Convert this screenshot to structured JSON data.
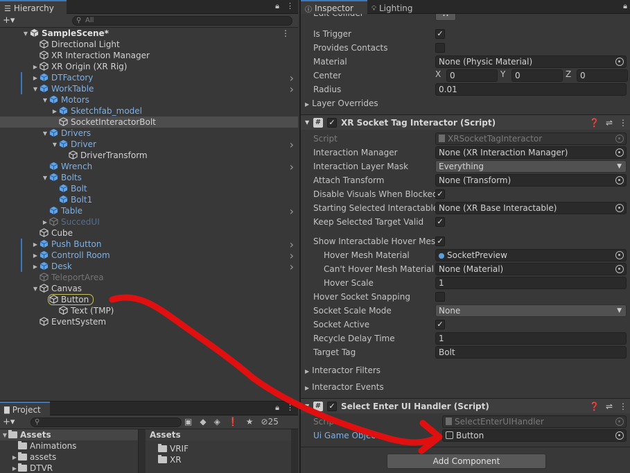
{
  "hierarchy": {
    "tab": "Hierarchy",
    "search_placeholder": "All",
    "items": [
      {
        "label": "SampleScene*",
        "indent": 0,
        "fold": "open",
        "kind": "scene"
      },
      {
        "label": "Directional Light",
        "indent": 1,
        "fold": "",
        "kind": "normal"
      },
      {
        "label": "XR Interaction Manager",
        "indent": 1,
        "fold": "",
        "kind": "normal"
      },
      {
        "label": "XR Origin (XR Rig)",
        "indent": 1,
        "fold": "closed",
        "kind": "normal"
      },
      {
        "label": "DTFactory",
        "indent": 1,
        "fold": "closed",
        "kind": "prefab",
        "arrow": true,
        "bar": true
      },
      {
        "label": "WorkTable",
        "indent": 1,
        "fold": "open",
        "kind": "prefab",
        "arrow": true,
        "bar": true
      },
      {
        "label": "Motors",
        "indent": 2,
        "fold": "open",
        "kind": "prefab"
      },
      {
        "label": "Sketchfab_model",
        "indent": 3,
        "fold": "closed",
        "kind": "prefab"
      },
      {
        "label": "SocketInteractorBolt",
        "indent": 3,
        "fold": "",
        "kind": "normal",
        "selected": true
      },
      {
        "label": "Drivers",
        "indent": 2,
        "fold": "open",
        "kind": "prefab"
      },
      {
        "label": "Driver",
        "indent": 3,
        "fold": "open",
        "kind": "prefab",
        "arrow": true
      },
      {
        "label": "DriverTransform",
        "indent": 4,
        "fold": "",
        "kind": "normal"
      },
      {
        "label": "Wrench",
        "indent": 2,
        "fold": "",
        "kind": "prefab",
        "arrow": true
      },
      {
        "label": "Bolts",
        "indent": 2,
        "fold": "open",
        "kind": "prefab"
      },
      {
        "label": "Bolt",
        "indent": 3,
        "fold": "",
        "kind": "prefab"
      },
      {
        "label": "Bolt1",
        "indent": 3,
        "fold": "",
        "kind": "prefab"
      },
      {
        "label": "Table",
        "indent": 2,
        "fold": "",
        "kind": "prefab",
        "arrow": true
      },
      {
        "label": "SuccedUI",
        "indent": 2,
        "fold": "closed",
        "kind": "dimblue"
      },
      {
        "label": "Cube",
        "indent": 1,
        "fold": "",
        "kind": "normal"
      },
      {
        "label": "Push Button",
        "indent": 1,
        "fold": "closed",
        "kind": "prefab",
        "arrow": true,
        "bar": true
      },
      {
        "label": "Controll Room",
        "indent": 1,
        "fold": "closed",
        "kind": "prefab",
        "arrow": true,
        "bar": true
      },
      {
        "label": "Desk",
        "indent": 1,
        "fold": "closed",
        "kind": "prefab",
        "arrow": true,
        "bar": true
      },
      {
        "label": "TeleportArea",
        "indent": 1,
        "fold": "",
        "kind": "dim"
      },
      {
        "label": "Canvas",
        "indent": 1,
        "fold": "open",
        "kind": "normal"
      },
      {
        "label": "Button",
        "indent": 2,
        "fold": "",
        "kind": "normal",
        "highlight": true
      },
      {
        "label": "Text (TMP)",
        "indent": 3,
        "fold": "",
        "kind": "normal"
      },
      {
        "label": "EventSystem",
        "indent": 1,
        "fold": "",
        "kind": "normal"
      }
    ]
  },
  "project": {
    "tab": "Project",
    "hidden_count": "25",
    "tree": [
      {
        "label": "Assets",
        "fold": "open",
        "head": true
      },
      {
        "label": "Animations",
        "fold": ""
      },
      {
        "label": "assets",
        "fold": "closed"
      },
      {
        "label": "DTVR",
        "fold": "closed"
      }
    ],
    "breadcrumb": "Assets",
    "files": [
      "VRIF",
      "XR"
    ]
  },
  "inspector": {
    "tabs": [
      "Inspector",
      "Lighting"
    ],
    "collider": {
      "edit_collider": "Edit Collider",
      "is_trigger": {
        "label": "Is Trigger",
        "checked": true
      },
      "provides_contacts": {
        "label": "Provides Contacts",
        "checked": false
      },
      "material": {
        "label": "Material",
        "value": "None (Physic Material)"
      },
      "center": {
        "label": "Center",
        "x_label": "X",
        "x": "0",
        "y_label": "Y",
        "y": "0",
        "z_label": "Z",
        "z": "0"
      },
      "radius": {
        "label": "Radius",
        "value": "0.01"
      },
      "layer_overrides": "Layer Overrides"
    },
    "socket": {
      "title": "XR Socket Tag Interactor (Script)",
      "script": {
        "label": "Script",
        "value": "XRSocketTagInteractor"
      },
      "interaction_manager": {
        "label": "Interaction Manager",
        "value": "None (XR Interaction Manager)"
      },
      "layer_mask": {
        "label": "Interaction Layer Mask",
        "value": "Everything"
      },
      "attach_transform": {
        "label": "Attach Transform",
        "value": "None (Transform)"
      },
      "disable_visuals": {
        "label": "Disable Visuals When Blocked In",
        "checked": true
      },
      "starting_selected": {
        "label": "Starting Selected Interactable",
        "value": "None (XR Base Interactable)"
      },
      "keep_selected": {
        "label": "Keep Selected Target Valid",
        "checked": true
      },
      "show_hover": {
        "label": "Show Interactable Hover Meshes",
        "checked": true
      },
      "hover_mesh_material": {
        "label": "Hover Mesh Material",
        "value": "SocketPreview"
      },
      "cant_hover_material": {
        "label": "Can't Hover Mesh Material",
        "value": "None (Material)"
      },
      "hover_scale": {
        "label": "Hover Scale",
        "value": "1"
      },
      "hover_snapping": {
        "label": "Hover Socket Snapping",
        "checked": false
      },
      "scale_mode": {
        "label": "Socket Scale Mode",
        "value": "None"
      },
      "socket_active": {
        "label": "Socket Active",
        "checked": true
      },
      "recycle_delay": {
        "label": "Recycle Delay Time",
        "value": "1"
      },
      "target_tag": {
        "label": "Target Tag",
        "value": "Bolt"
      },
      "interactor_filters": "Interactor Filters",
      "interactor_events": "Interactor Events"
    },
    "select_enter": {
      "title": "Select Enter UI Handler (Script)",
      "script": {
        "label": "Script",
        "value": "SelectEnterUIHandler"
      },
      "ui_game_object": {
        "label": "Ui Game Object",
        "value": "Button"
      }
    },
    "add_component": "Add Component"
  },
  "annotation_color": "#e01010"
}
